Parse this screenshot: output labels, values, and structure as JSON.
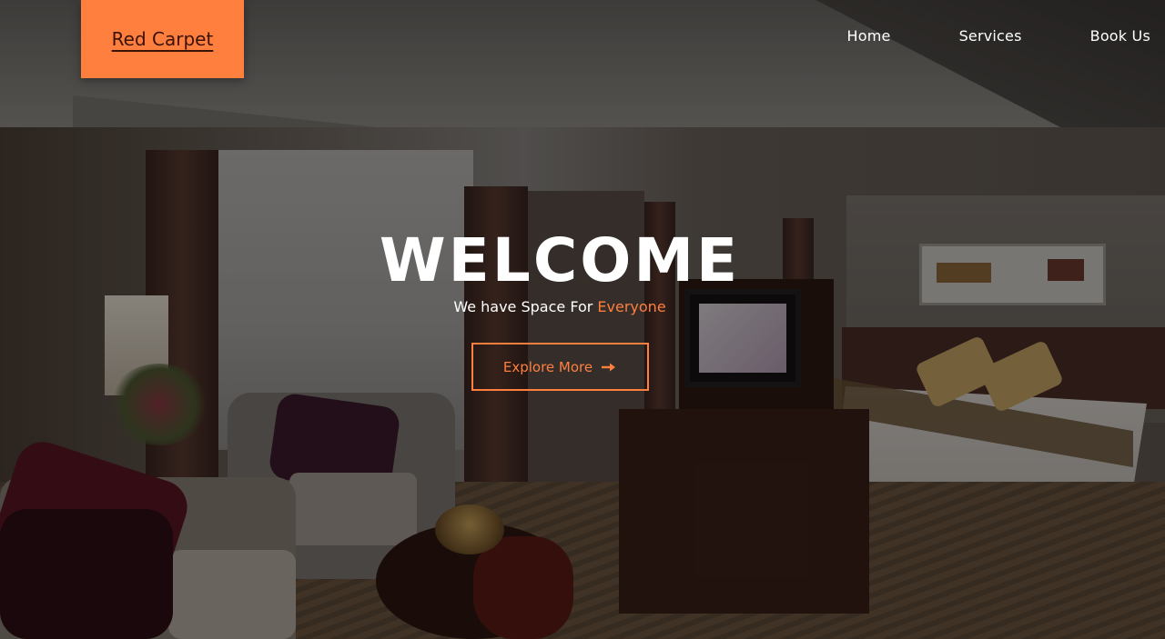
{
  "brand": {
    "name": "Red Carpet"
  },
  "nav": {
    "items": [
      {
        "label": "Home"
      },
      {
        "label": "Services"
      },
      {
        "label": "Book Us"
      }
    ]
  },
  "hero": {
    "title": "WELCOME",
    "subtitle_prefix": "We have Space For ",
    "subtitle_highlight": "Everyone",
    "cta_label": "Explore More",
    "cta_icon": "arrow-right-icon",
    "background_image": "hotel-suite-photo"
  },
  "colors": {
    "accent": "#ff7f3f",
    "logo_text": "#3a1206",
    "text": "#ffffff"
  }
}
